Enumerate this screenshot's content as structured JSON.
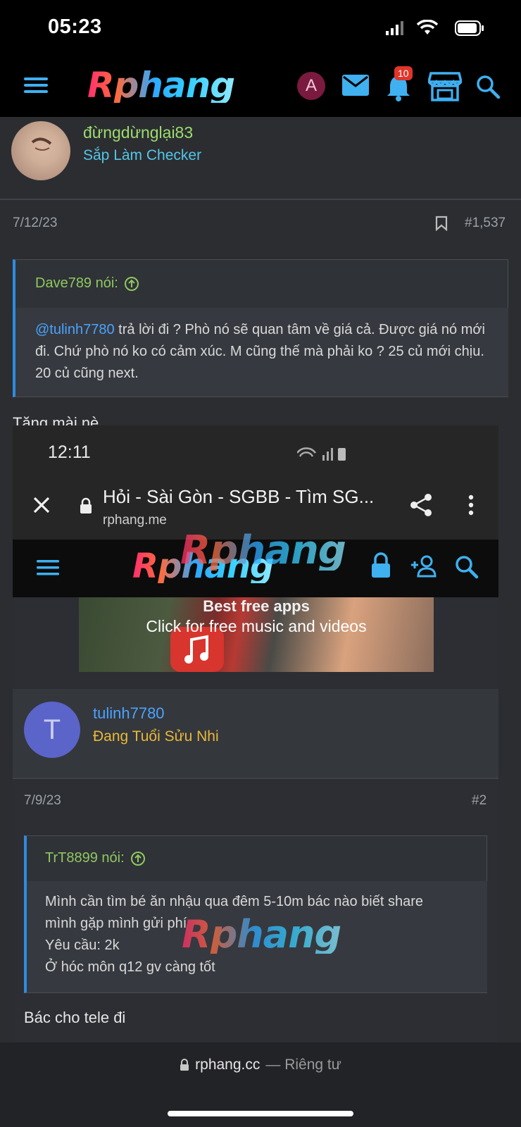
{
  "status_bar": {
    "time": "05:23"
  },
  "header": {
    "logo": "Rphang",
    "avatar_letter": "A",
    "notification_count": "10"
  },
  "post": {
    "username": "đừngdừnglại83",
    "user_title": "Sắp Làm Checker",
    "date": "7/12/23",
    "number": "#1,537",
    "quote": {
      "author": "Dave789 nói:",
      "mention": "@tulinh7780",
      "body": " trả lời đi ? Phò nó sẽ quan tâm về giá cả. Được giá nó mới đi. Chứ phò nó ko có cảm xúc. M cũng thế mà phải ko ? 25 củ mới chịu. 20 củ cũng next."
    },
    "message": "Tặng mài nè"
  },
  "embedded": {
    "status_time": "12:11",
    "tab_title": "Hỏi - Sài Gòn - SGBB - Tìm SG...",
    "domain": "rphang.me",
    "logo": "Rphang",
    "watermark": "Rphang",
    "banner": {
      "line1": "Best free apps",
      "line2": "Click for free music and videos"
    },
    "post": {
      "avatar_letter": "T",
      "username": "tulinh7780",
      "user_title": "Đang Tuổi Sửu Nhi",
      "date": "7/9/23",
      "number": "#2",
      "quote": {
        "author": "TrT8899 nói:",
        "lines": [
          "Mình cần tìm bé ăn nhậu qua đêm 5-10m bác nào biết share",
          "mình gặp mình gửi phí",
          "Yêu cầu: 2k",
          "Ở hóc môn q12 gv càng tốt"
        ]
      },
      "message": "Bác cho tele đi"
    }
  },
  "bottom_bar": {
    "domain": "rphang.cc",
    "privacy": "— Riêng tư"
  },
  "colors": {
    "background": "#2b2d31",
    "header": "#000000",
    "accent": "#2f8be0",
    "username_green": "#9ddc6f",
    "title_cyan": "#55c6e8",
    "badge_red": "#e0352b"
  }
}
